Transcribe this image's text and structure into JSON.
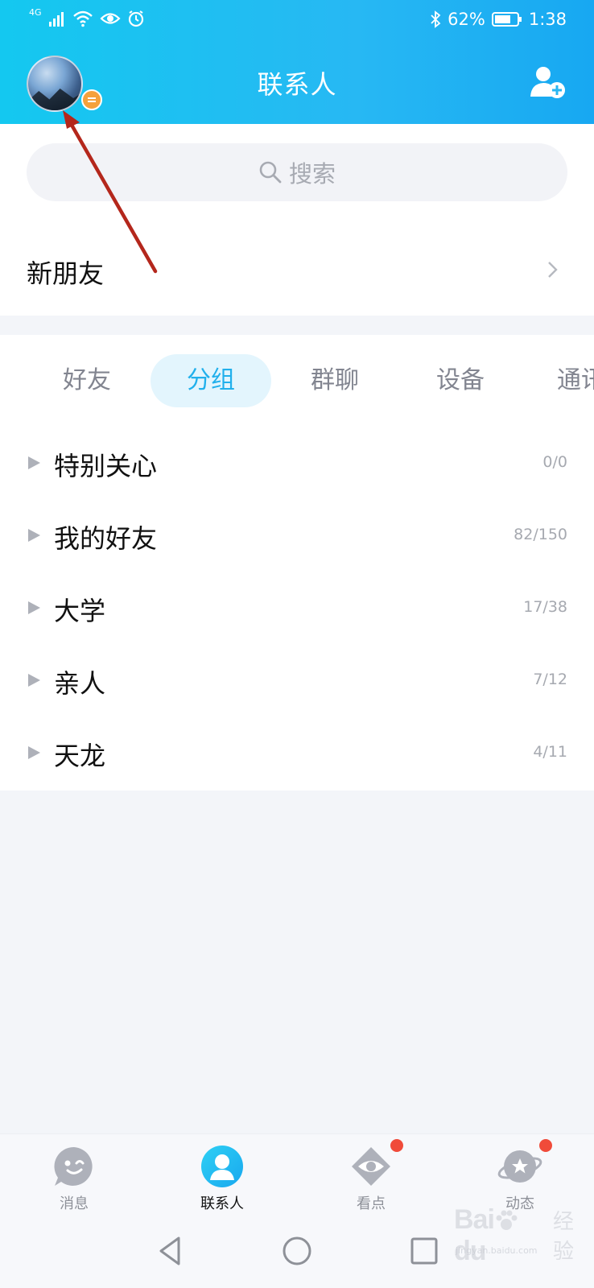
{
  "statusbar": {
    "network": "4G",
    "battery_percent": "62%",
    "time": "1:38"
  },
  "header": {
    "title": "联系人"
  },
  "search": {
    "placeholder": "搜索"
  },
  "new_friends": {
    "label": "新朋友"
  },
  "tabs": [
    {
      "label": "好友",
      "active": false
    },
    {
      "label": "分组",
      "active": true
    },
    {
      "label": "群聊",
      "active": false
    },
    {
      "label": "设备",
      "active": false
    },
    {
      "label": "通讯录",
      "active": false
    }
  ],
  "groups": [
    {
      "name": "特别关心",
      "count": "0/0"
    },
    {
      "name": "我的好友",
      "count": "82/150"
    },
    {
      "name": "大学",
      "count": "17/38"
    },
    {
      "name": "亲人",
      "count": "7/12"
    },
    {
      "name": "天龙",
      "count": "4/11"
    }
  ],
  "bottom_nav": [
    {
      "label": "消息",
      "icon": "message-icon",
      "active": false,
      "badge": false
    },
    {
      "label": "联系人",
      "icon": "contacts-icon",
      "active": true,
      "badge": false
    },
    {
      "label": "看点",
      "icon": "eye-icon",
      "active": false,
      "badge": true
    },
    {
      "label": "动态",
      "icon": "planet-star-icon",
      "active": false,
      "badge": true
    }
  ],
  "watermark": {
    "logo": "Bai",
    "logo2": "du",
    "cn": "经验",
    "sub": "jingyan.baidu.com"
  },
  "colors": {
    "accent": "#21b0ec",
    "header_start": "#14c8f0",
    "badge": "#f04b3a",
    "status_dot": "#f5a13c",
    "annotation_arrow": "#b4271c"
  }
}
